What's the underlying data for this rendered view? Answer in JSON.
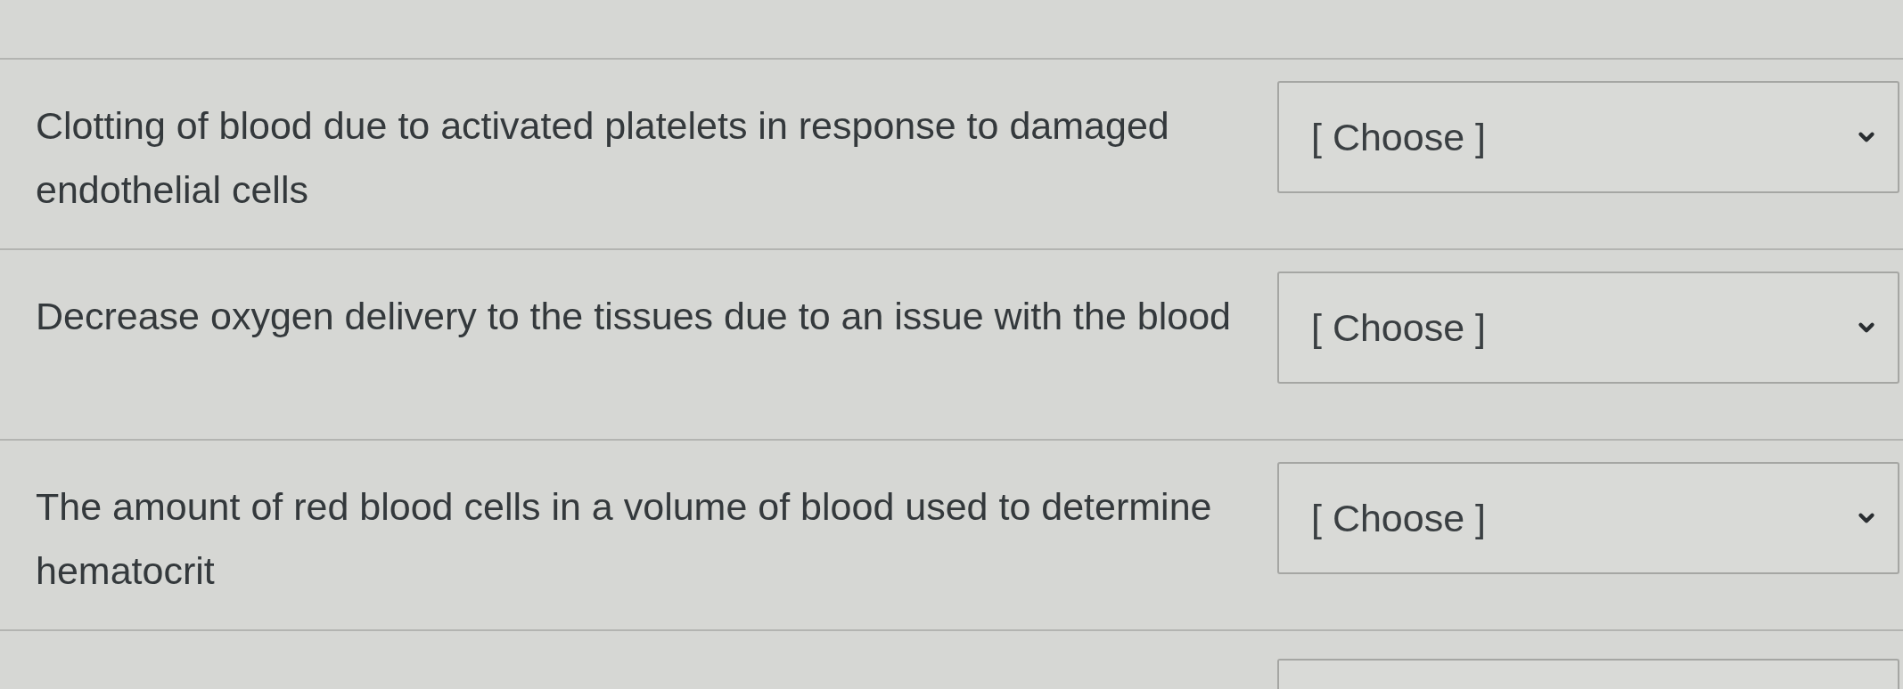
{
  "questions": [
    {
      "prompt": "Clotting of blood due to activated platelets in response to damaged endothelial cells",
      "answer": {
        "value": "[ Choose ]"
      }
    },
    {
      "prompt": "Decrease oxygen delivery to the tissues due to an issue with the blood",
      "answer": {
        "value": "[ Choose ]"
      }
    },
    {
      "prompt": "The amount of red blood cells in a volume of blood used to determine hematocrit",
      "answer": {
        "value": "[ Choose ]"
      }
    }
  ]
}
